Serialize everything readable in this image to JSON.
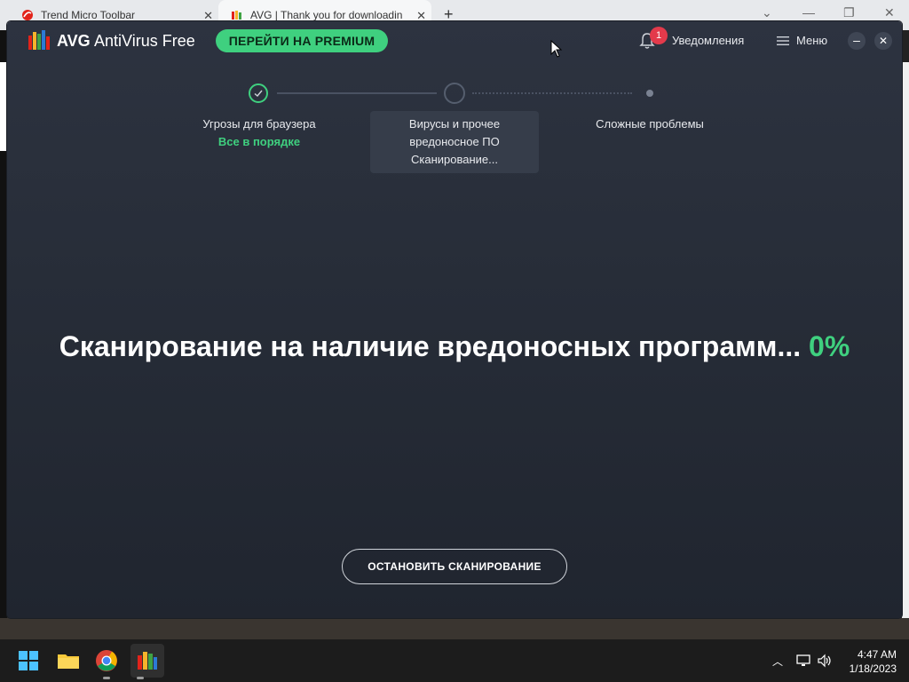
{
  "browser": {
    "tabs": [
      {
        "label": "Trend Micro Toolbar"
      },
      {
        "label": "AVG | Thank you for downloadin"
      }
    ]
  },
  "app": {
    "brand": "AVG",
    "product": "AntiVirus Free",
    "premium_label": "ПЕРЕЙТИ НА PREMIUM",
    "notifications_count": "1",
    "notifications_label": "Уведомления",
    "menu_label": "Меню"
  },
  "steps": [
    {
      "label": "Угрозы для браузера",
      "status": "Все в порядке"
    },
    {
      "line1": "Вирусы и прочее",
      "line2": "вредоносное ПО",
      "status": "Сканирование..."
    },
    {
      "label": "Сложные проблемы"
    }
  ],
  "scan": {
    "message": "Сканирование на наличие вредоносных программ...",
    "percent": "0%",
    "progress": 0,
    "stop_label": "ОСТАНОВИТЬ СКАНИРОВАНИЕ"
  },
  "taskbar": {
    "time": "4:47 AM",
    "date": "1/18/2023"
  },
  "colors": {
    "accent_green": "#3fd07f",
    "badge_red": "#e33a4b",
    "window_bg": "#262c37"
  }
}
